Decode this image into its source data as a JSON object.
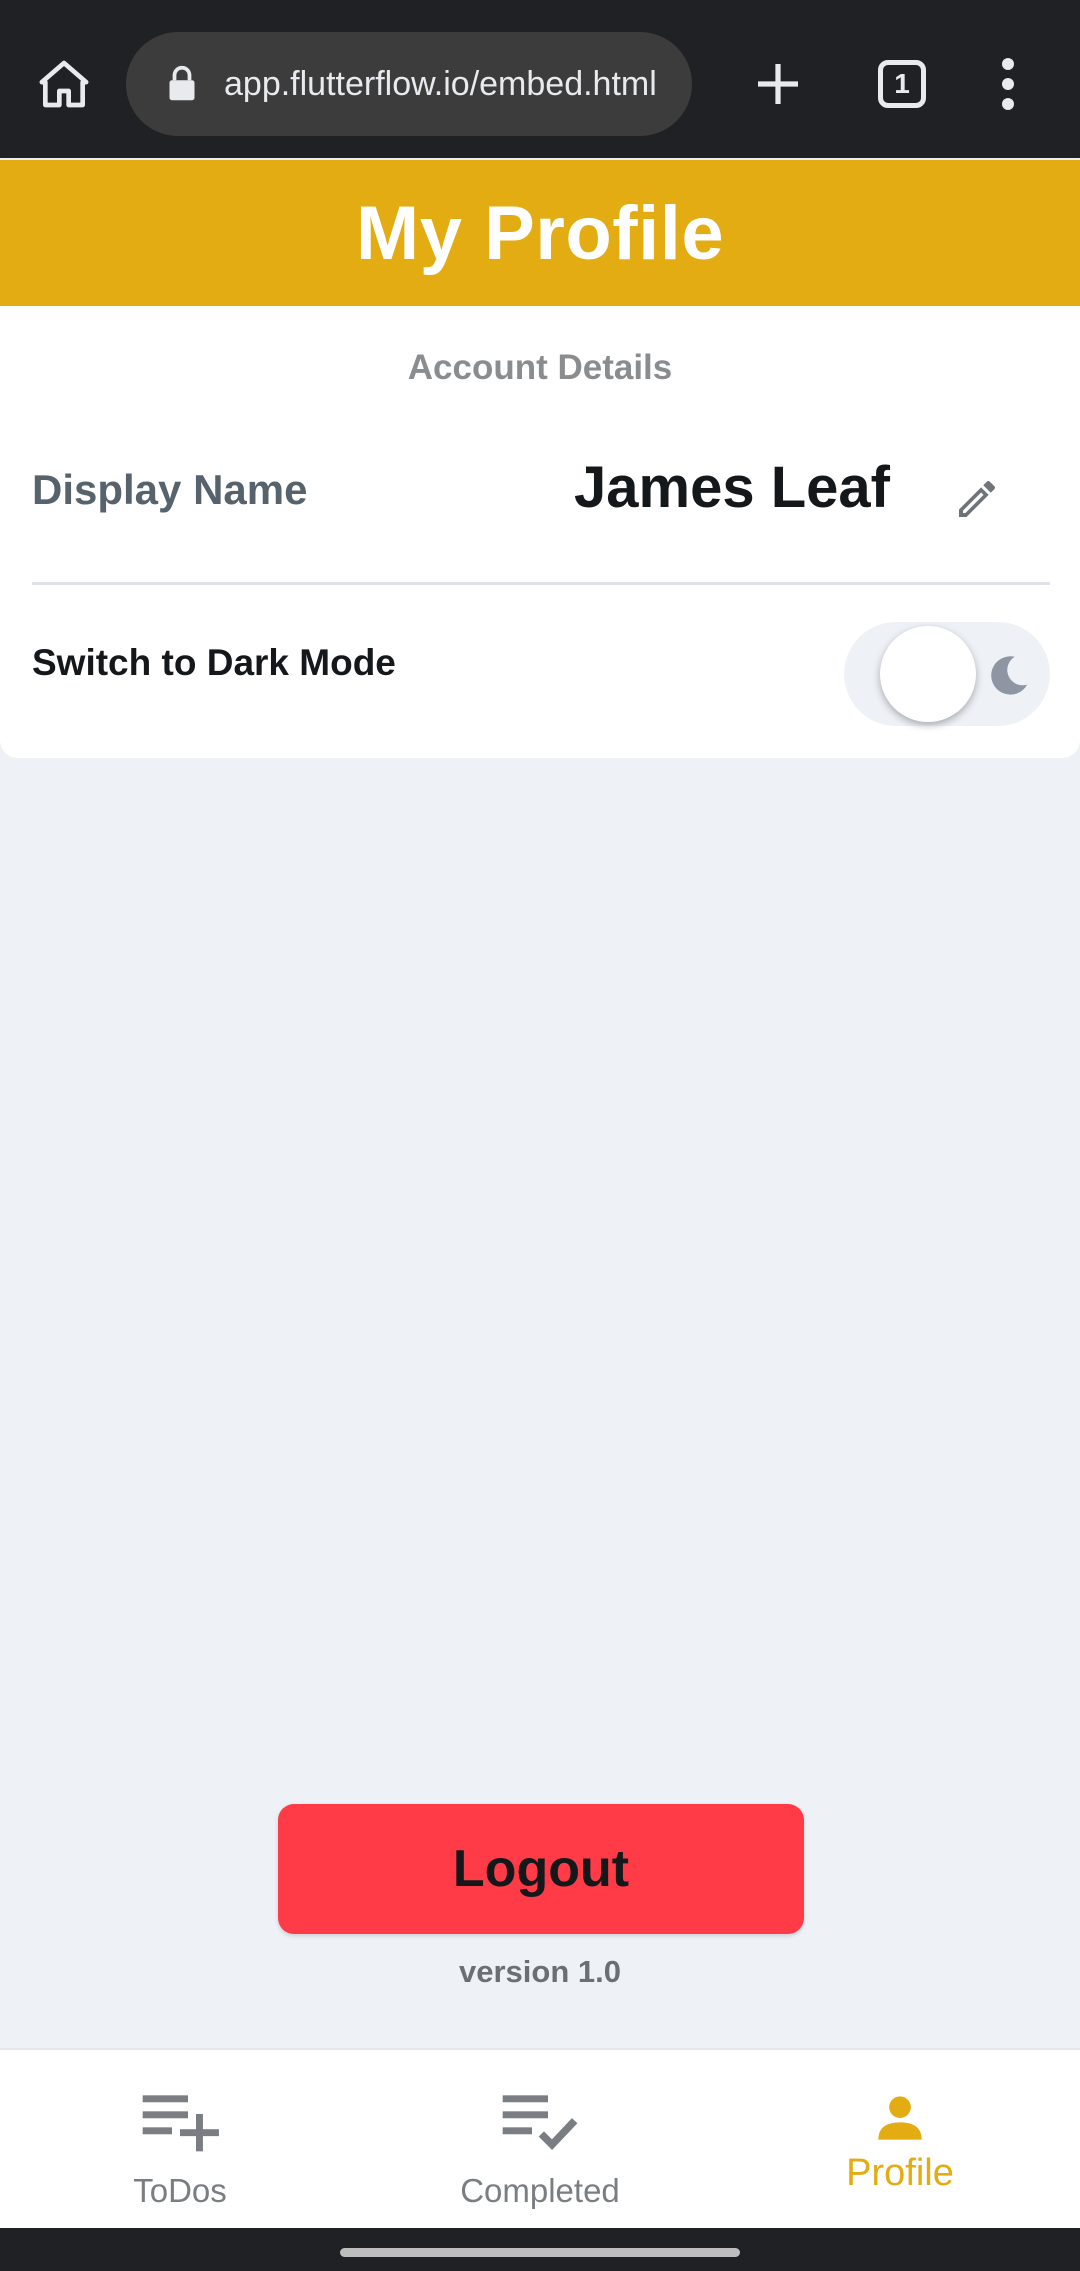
{
  "browser": {
    "url": "app.flutterflow.io/embed.html",
    "tab_count": "1",
    "icons": {
      "home": "home-icon",
      "lock": "lock-icon",
      "new_tab": "plus-icon",
      "menu": "more-vert-icon"
    }
  },
  "header": {
    "title": "My Profile",
    "color": "#e3ac12"
  },
  "account": {
    "section_label": "Account Details",
    "display_name_label": "Display Name",
    "display_name_value": "James Leaf",
    "dark_mode_label": "Switch to Dark Mode",
    "dark_mode_on": false
  },
  "logout": {
    "label": "Logout",
    "color": "#ff3b47"
  },
  "version": "version 1.0",
  "bottom_nav": {
    "items": [
      {
        "label": "ToDos",
        "icon": "playlist-add-icon",
        "active": false
      },
      {
        "label": "Completed",
        "icon": "playlist-add-check-icon",
        "active": false
      },
      {
        "label": "Profile",
        "icon": "person-icon",
        "active": true
      }
    ],
    "active_color": "#e3ac12"
  }
}
